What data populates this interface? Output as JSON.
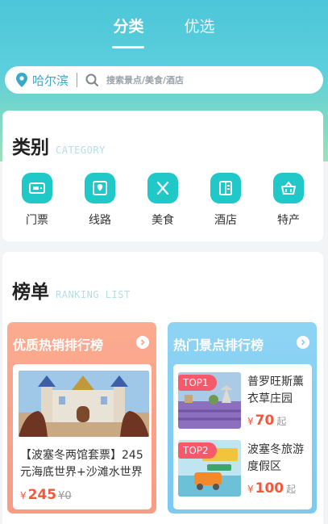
{
  "tabs": [
    {
      "label": "分类",
      "active": true
    },
    {
      "label": "优选",
      "active": false
    }
  ],
  "search": {
    "city": "哈尔滨",
    "placeholder": "搜索景点/美食/酒店"
  },
  "category": {
    "title_zh": "类别",
    "title_en": "CATEGORY",
    "items": [
      {
        "label": "门票",
        "icon": "ticket-icon"
      },
      {
        "label": "线路",
        "icon": "route-map-icon"
      },
      {
        "label": "美食",
        "icon": "fork-knife-icon"
      },
      {
        "label": "酒店",
        "icon": "hotel-building-icon"
      },
      {
        "label": "特产",
        "icon": "basket-icon"
      }
    ]
  },
  "ranking": {
    "title_zh": "榜单",
    "title_en": "RANKING LIST",
    "hot_sale": {
      "title": "优质热销排行榜",
      "item": {
        "desc": "【波塞冬两馆套票】245元海底世界+沙滩水世界",
        "currency": "¥",
        "price": "245",
        "old_price": "¥0"
      }
    },
    "hot_spots": {
      "title": "热门景点排行榜",
      "items": [
        {
          "badge": "TOP1",
          "name": "普罗旺斯薰衣草庄园",
          "currency": "¥",
          "price": "70",
          "suffix": "起"
        },
        {
          "badge": "TOP2",
          "name": "波塞冬旅游度假区",
          "currency": "¥",
          "price": "100",
          "suffix": "起"
        }
      ]
    }
  },
  "colors": {
    "accent": "#21c8c8",
    "price": "#f4583a",
    "hot_sale_panel": "#fba38b",
    "hot_spots_panel": "#86cff2",
    "badge": "#f45a6a"
  }
}
